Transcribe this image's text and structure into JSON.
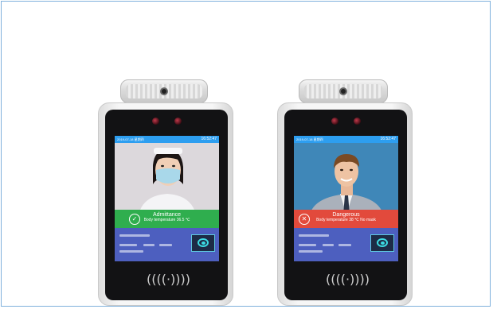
{
  "devices": [
    {
      "status": "admit",
      "date": "2019-07-18 星期四",
      "time": "16:52:47",
      "banner_title": "Admittance",
      "banner_detail": "Body temperature 36.5 ℃",
      "banner_color": "#2fae4e",
      "banner_icon": "check-circle-icon",
      "nfc_label": "((((·))))"
    },
    {
      "status": "danger",
      "date": "2019-07-18 星期四",
      "time": "16:52:47",
      "banner_title": "Dangerous",
      "banner_detail": "Body temperature 38 ℃    No mask",
      "banner_color": "#e24a3c",
      "banner_icon": "x-circle-icon",
      "nfc_label": "((((·))))"
    }
  ]
}
